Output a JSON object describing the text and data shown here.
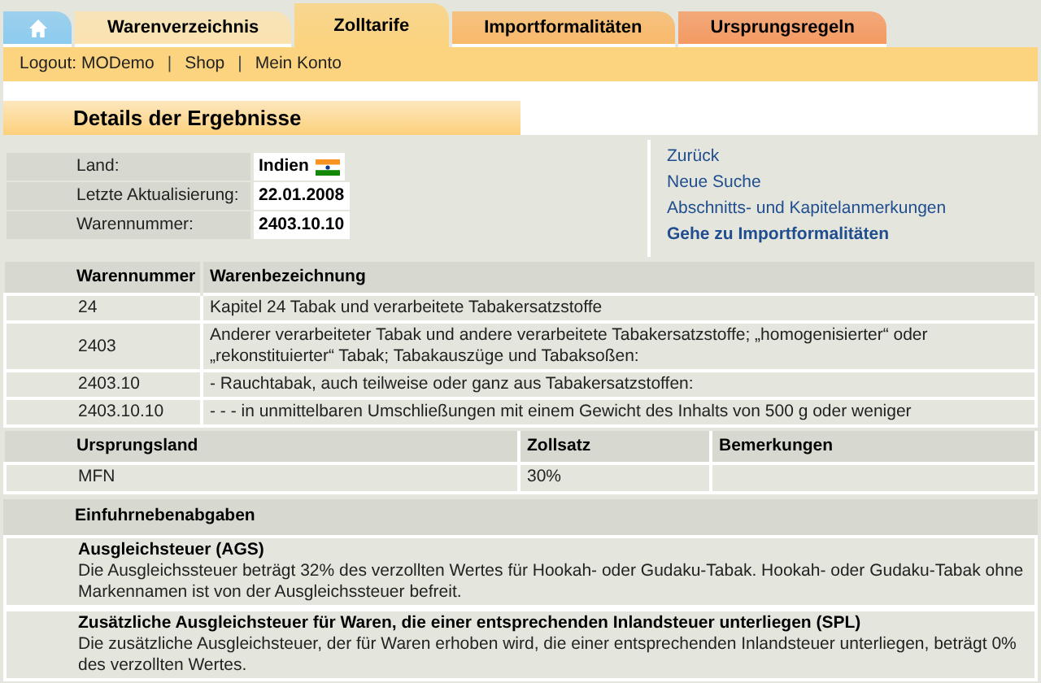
{
  "tabs": [
    {
      "kind": "home",
      "selected": false,
      "color": "#8ccbf0"
    },
    {
      "kind": "label",
      "label": "Warenverzeichnis",
      "selected": false,
      "color": "#fbe3b0"
    },
    {
      "kind": "label",
      "label": "Zolltarife",
      "selected": true,
      "color": "#fcd37e"
    },
    {
      "kind": "label",
      "label": "Importformalitäten",
      "selected": false,
      "color": "#f9b96a"
    },
    {
      "kind": "label",
      "label": "Ursprungsregeln",
      "selected": false,
      "color": "#f59a62"
    }
  ],
  "nav": [
    {
      "kind": "link",
      "text": "Logout: MODemo"
    },
    {
      "kind": "separator",
      "text": "|"
    },
    {
      "kind": "link",
      "text": "Shop"
    },
    {
      "kind": "separator",
      "text": "|"
    },
    {
      "kind": "link",
      "text": "Mein Konto"
    }
  ],
  "section_title": "Details der Ergebnisse",
  "details": [
    {
      "label": "Land:",
      "value": "Indien",
      "flag": true
    },
    {
      "label": "Letzte Aktualisierung:",
      "value": "22.01.2008",
      "flag": false
    },
    {
      "label": "Warennummer:",
      "value": "2403.10.10",
      "flag": false
    }
  ],
  "links": [
    {
      "text": "Zurück",
      "bold": false
    },
    {
      "text": "Neue Suche",
      "bold": false
    },
    {
      "text": "Abschnitts- und Kapitelanmerkungen",
      "bold": false
    },
    {
      "text": "Gehe zu Importformalitäten",
      "bold": true
    }
  ],
  "goods_table": {
    "columns": [
      "Warennummer",
      "Warenbezeichnung"
    ],
    "rows": [
      [
        "24",
        "Kapitel 24 Tabak und verarbeitete Tabakersatzstoffe"
      ],
      [
        "2403",
        "Anderer verarbeiteter Tabak und andere verarbeitete Tabakersatzstoffe; „homogenisierter“ oder „rekonstituierter“ Tabak; Tabakauszüge und Tabaksoßen:"
      ],
      [
        "2403.10",
        "- Rauchtabak, auch teilweise oder ganz aus Tabakersatzstoffen:"
      ],
      [
        "2403.10.10",
        "- - - in unmittelbaren Umschließungen mit einem Gewicht des Inhalts von 500 g oder weniger"
      ]
    ]
  },
  "duty_table": {
    "columns": [
      "Ursprungsland",
      "Zollsatz",
      "Bemerkungen"
    ],
    "rows": [
      [
        "MFN",
        "30%",
        ""
      ]
    ]
  },
  "charges": {
    "title": "Einfuhrnebenabgaben",
    "items": [
      {
        "title": "Ausgleichsteuer (AGS)",
        "text": "Die Ausgleichssteuer beträgt 32% des verzollten Wertes für Hookah- oder Gudaku-Tabak. Hookah- oder Gudaku-Tabak ohne Markennamen ist von der Ausgleichssteuer befreit."
      },
      {
        "title": "Zusätzliche Ausgleichsteuer für Waren, die einer entsprechenden Inlandsteuer unterliegen (SPL)",
        "text": "Die zusätzliche Ausgleichsteuer, der für Waren erhoben wird, die einer entsprechenden Inlandsteuer unterliegen, beträgt 0% des verzollten Wertes."
      }
    ]
  }
}
